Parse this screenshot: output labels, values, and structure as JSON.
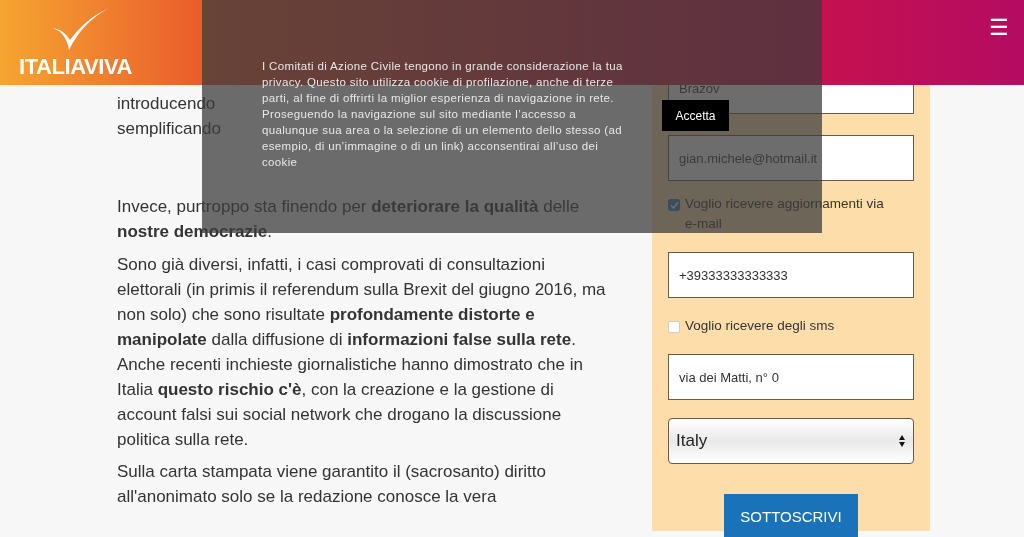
{
  "header": {
    "logo_text": "ITALIAVIVA",
    "menu_icon": "☰"
  },
  "article": {
    "paragraphs": [
      {
        "lines": [
          "introducendo",
          "semplificando"
        ]
      },
      {
        "lines": [
          "Invece, purtroppo sta finendo per **deteriorare la qualità** delle **nostre democrazie**."
        ]
      },
      {
        "lines": [
          "Sono già diversi, infatti, i casi comprovati di consultazioni elettorali (in primis il referendum sulla Brexit del giugno 2016, ma non solo) che sono risultate **profondamente distorte e manipolate** dalla diffusione di **informazioni false sulla rete**.",
          "Anche recenti inchieste giornalistiche hanno dimostrato che in Italia **questo rischio c'è**, con la creazione e la gestione di account falsi sui social network che drogano la discussione politica sulla rete."
        ]
      },
      {
        "lines": [
          "Sulla carta stampata viene garantito il (sacrosanto) diritto all'anonimato solo se la redazione conosce la vera"
        ]
      }
    ]
  },
  "form": {
    "items": [
      {
        "kind": "field",
        "value": "Brazov"
      },
      {
        "kind": "field",
        "value": "gian.michele@hotmail.it"
      },
      {
        "kind": "checkbox",
        "label": "Voglio ricevere aggiornamenti via e-mail",
        "checked": true
      },
      {
        "kind": "field",
        "value": "+39333333333333"
      },
      {
        "kind": "checkbox",
        "label": "Voglio ricevere degli sms",
        "checked": false
      },
      {
        "kind": "field",
        "value": "via dei Matti, n° 0"
      },
      {
        "kind": "select",
        "value": "Italy"
      }
    ],
    "submit": "SOTTOSCRIVI"
  },
  "cookie_banner": {
    "text": "I Comitati di Azione Civile tengono in grande considerazione la tua privacy. Questo sito utilizza cookie di profilazione, anche di terze parti, al fine di offrirti la miglior esperienza di navigazione in rete. Proseguendo la navigazione sul sito mediante l’accesso a qualunque sua area o la selezione di un elemento dello stesso (ad esempio, di un’immagine o di un link) acconsentirai all’uso dei cookie",
    "button": "Accetta"
  }
}
